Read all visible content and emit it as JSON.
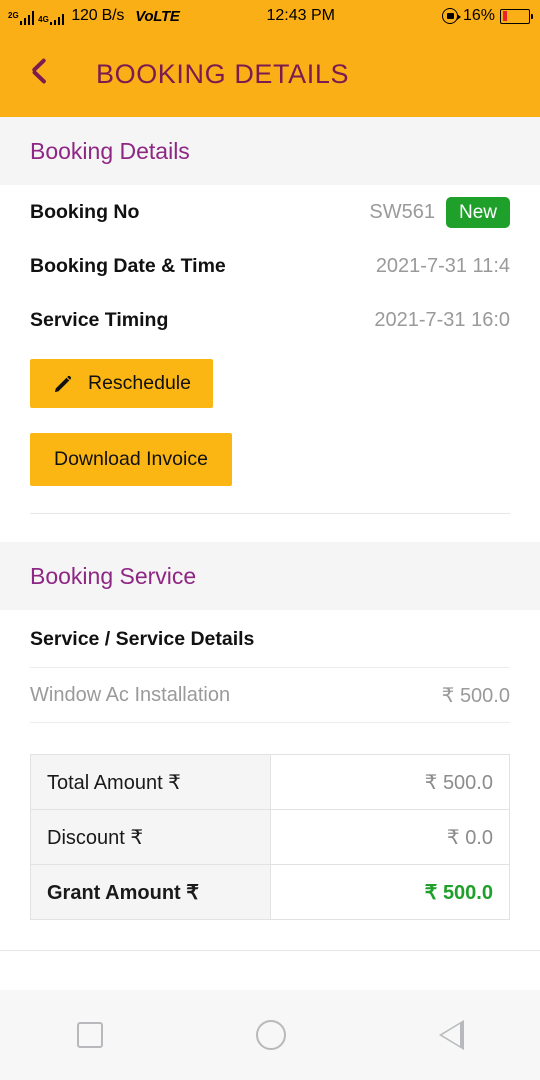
{
  "status_bar": {
    "network_2g_label": "2G",
    "network_4g_label": "4G",
    "lte_small_label": "LTE",
    "net_speed": "120 B/s",
    "volte": "VoLTE",
    "time": "12:43 PM",
    "battery_percent": "16%",
    "battery_level": 16,
    "battery_color": "#E8232A",
    "rotation_lock_icon": "rotation-lock-icon"
  },
  "app_bar": {
    "back_icon": "back-chevron-icon",
    "title": "BOOKING DETAILS",
    "bg_color": "#FBAF17",
    "title_color": "#7B1B4F"
  },
  "booking_details": {
    "section_title": "Booking Details",
    "rows": [
      {
        "label": "Booking No",
        "value": "SW561",
        "badge": "New",
        "badge_color": "#1FA02A"
      },
      {
        "label": "Booking Date & Time",
        "value": "2021-7-31 11:4"
      },
      {
        "label": "Service Timing",
        "value": "2021-7-31 16:0"
      }
    ],
    "reschedule_button": "Reschedule",
    "reschedule_icon": "pencil-icon",
    "download_invoice_button": "Download Invoice",
    "button_color": "#FBB614"
  },
  "booking_service": {
    "section_title": "Booking Service",
    "table_header": "Service / Service Details",
    "items": [
      {
        "name": "Window Ac Installation",
        "amount": "₹ 500.0"
      }
    ],
    "amounts": [
      {
        "label": "Total Amount ₹",
        "value": "₹ 500.0",
        "emphasis": false
      },
      {
        "label": "Discount ₹",
        "value": "₹ 0.0",
        "emphasis": false
      },
      {
        "label": "Grant Amount ₹",
        "value": "₹ 500.0",
        "emphasis": true
      }
    ],
    "total_color": "#1FA02A"
  },
  "nav_bar": {
    "recents_icon": "square-recents-icon",
    "home_icon": "circle-home-icon",
    "back_icon": "triangle-back-icon"
  }
}
